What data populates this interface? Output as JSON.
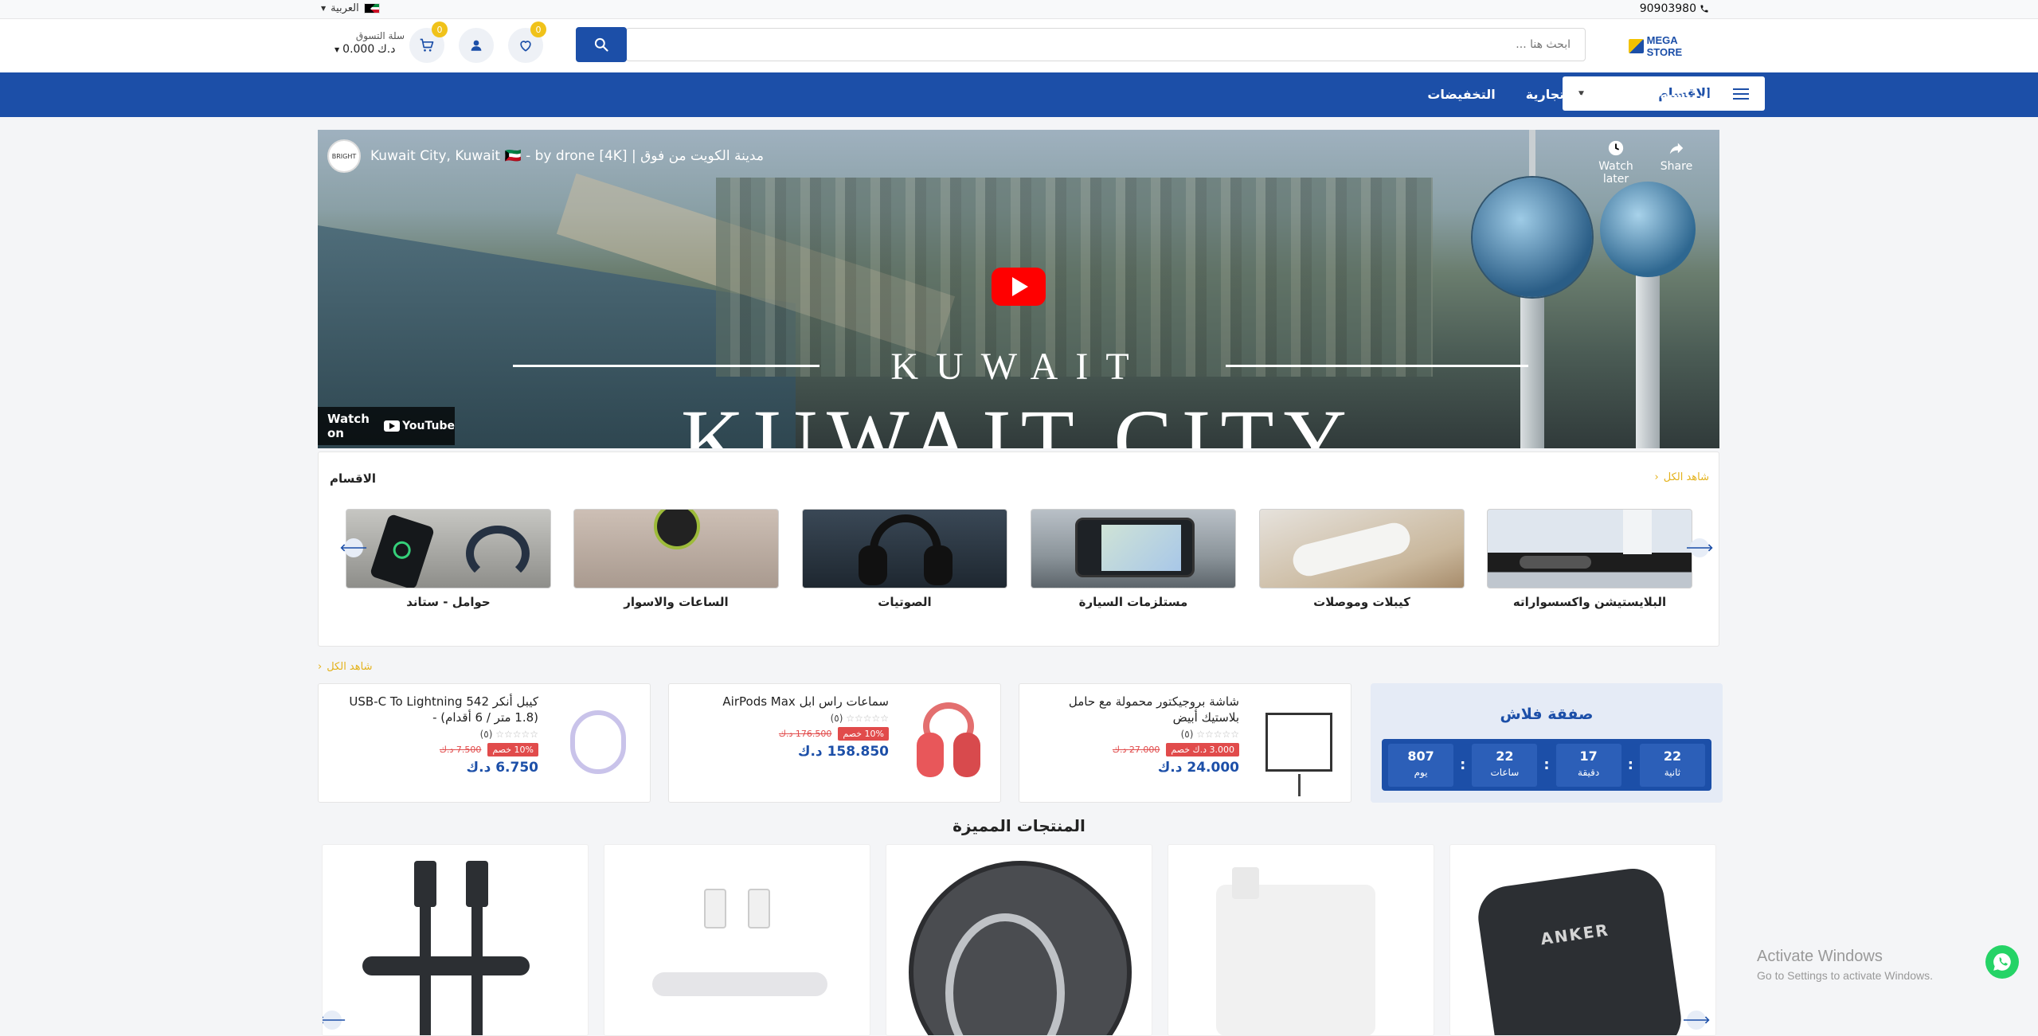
{
  "topbar": {
    "phone": "90903980",
    "language": "العربية"
  },
  "header": {
    "logo": "MEGA STORE",
    "search_placeholder": "ابحث هنا ...",
    "wishlist_count": "0",
    "cart_count": "0",
    "cart_label": "سلة التسوق",
    "cart_total": "0.000",
    "currency": "د.ك"
  },
  "nav": {
    "categories_label": "الاقسام",
    "links": [
      "الرئيسيه",
      "العلامات التجارية",
      "التخفيضات"
    ]
  },
  "video": {
    "title": "Kuwait City, Kuwait 🇰🇼 - by drone [4K] | مدينة الكويت من فوق",
    "channel_badge": "BRIGHT",
    "watch_later": "Watch later",
    "share": "Share",
    "watch_on": "Watch on",
    "youtube": "YouTube",
    "overlay_line1": "KUWAIT",
    "overlay_line2": "KUWAIT CITY"
  },
  "categories_section": {
    "title": "الاقسام",
    "view_all": "شاهد الكل",
    "items": [
      {
        "label": "البلايستيشن واكسسواراته"
      },
      {
        "label": "كيبلات وموصلات"
      },
      {
        "label": "مستلزمات السيارة"
      },
      {
        "label": "الصوتيات"
      },
      {
        "label": "الساعات والاسوار"
      },
      {
        "label": "حوامل - ستاند"
      }
    ]
  },
  "flash": {
    "view_all": "شاهد الكل",
    "title": "صفقة فلاش",
    "timer": [
      {
        "value": "22",
        "unit": "ثانية"
      },
      {
        "value": "17",
        "unit": "دقيقة"
      },
      {
        "value": "22",
        "unit": "ساعات"
      },
      {
        "value": "807",
        "unit": "يوم"
      }
    ],
    "products": [
      {
        "name": "شاشة بروجيكتور محمولة مع حامل بلاستيك أبيض",
        "rating": "(٥)",
        "discount": "3.000 د.ك خصم",
        "old_price": "27.000 د.ك",
        "price": "24.000 د.ك"
      },
      {
        "name": "سماعات راس ابل AirPods Max",
        "rating": "(٥)",
        "discount": "10% خصم",
        "old_price": "176.500 د.ك",
        "price": "158.850 د.ك"
      },
      {
        "name": "كيبل أنكر 542 USB-C To Lightning (1.8 متر / 6 أقدام) -",
        "rating": "(٥)",
        "discount": "10% خصم",
        "old_price": "7.500 د.ك",
        "price": "6.750 د.ك"
      }
    ]
  },
  "featured": {
    "title": "المنتجات المميزة",
    "brand_text": "ANKER"
  },
  "windows": {
    "line1": "Activate Windows",
    "line2": "Go to Settings to activate Windows."
  },
  "colors": {
    "primary": "#1c4fa8",
    "accent": "#f0c21a",
    "sale": "#e14b4b",
    "whatsapp": "#25d366"
  }
}
